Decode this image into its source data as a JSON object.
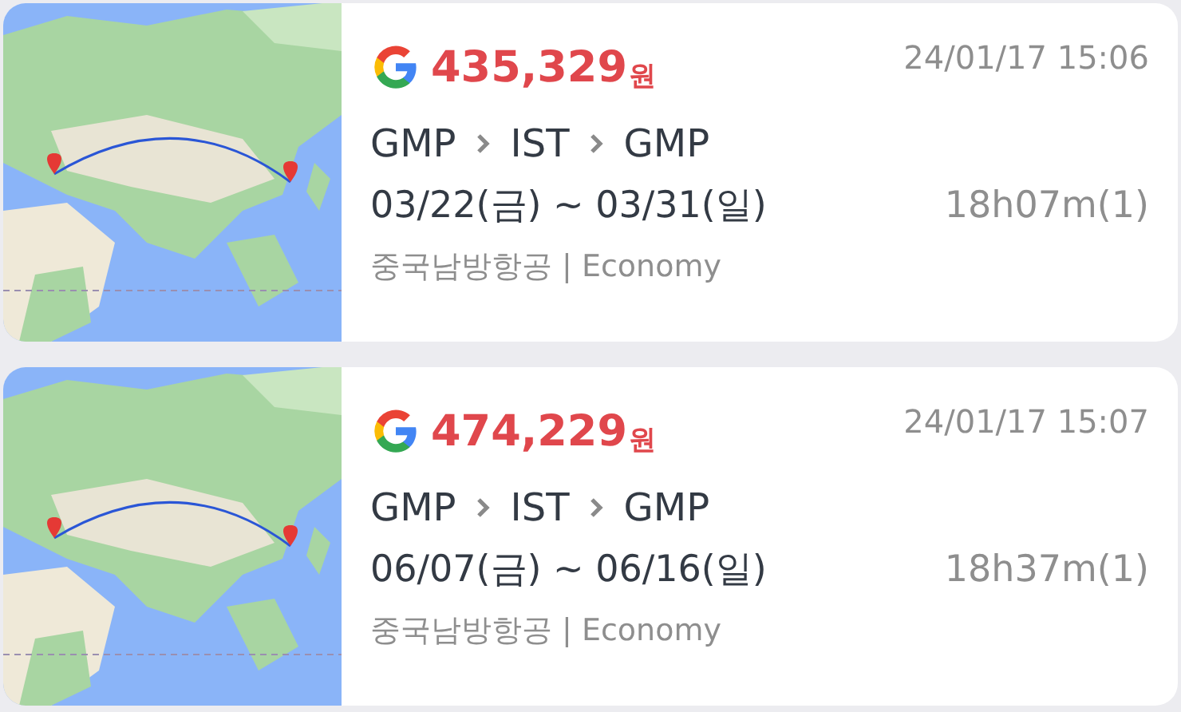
{
  "results": [
    {
      "kind": "picture",
      "price": "435,329",
      "currency": "원",
      "timestamp": "24/01/17 15:06",
      "route": [
        "GMP",
        "IST",
        "GMP"
      ],
      "dates": "03/22(금) ~ 03/31(일)",
      "duration": "18h07m(1)",
      "airline": "중국남방항공 | Economy"
    },
    {
      "kind": "picture",
      "price": "474,229",
      "currency": "원",
      "timestamp": "24/01/17 15:07",
      "route": [
        "GMP",
        "IST",
        "GMP"
      ],
      "dates": "06/07(금) ~ 06/16(일)",
      "duration": "18h37m(1)",
      "airline": "중국남방항공 | Economy"
    }
  ]
}
